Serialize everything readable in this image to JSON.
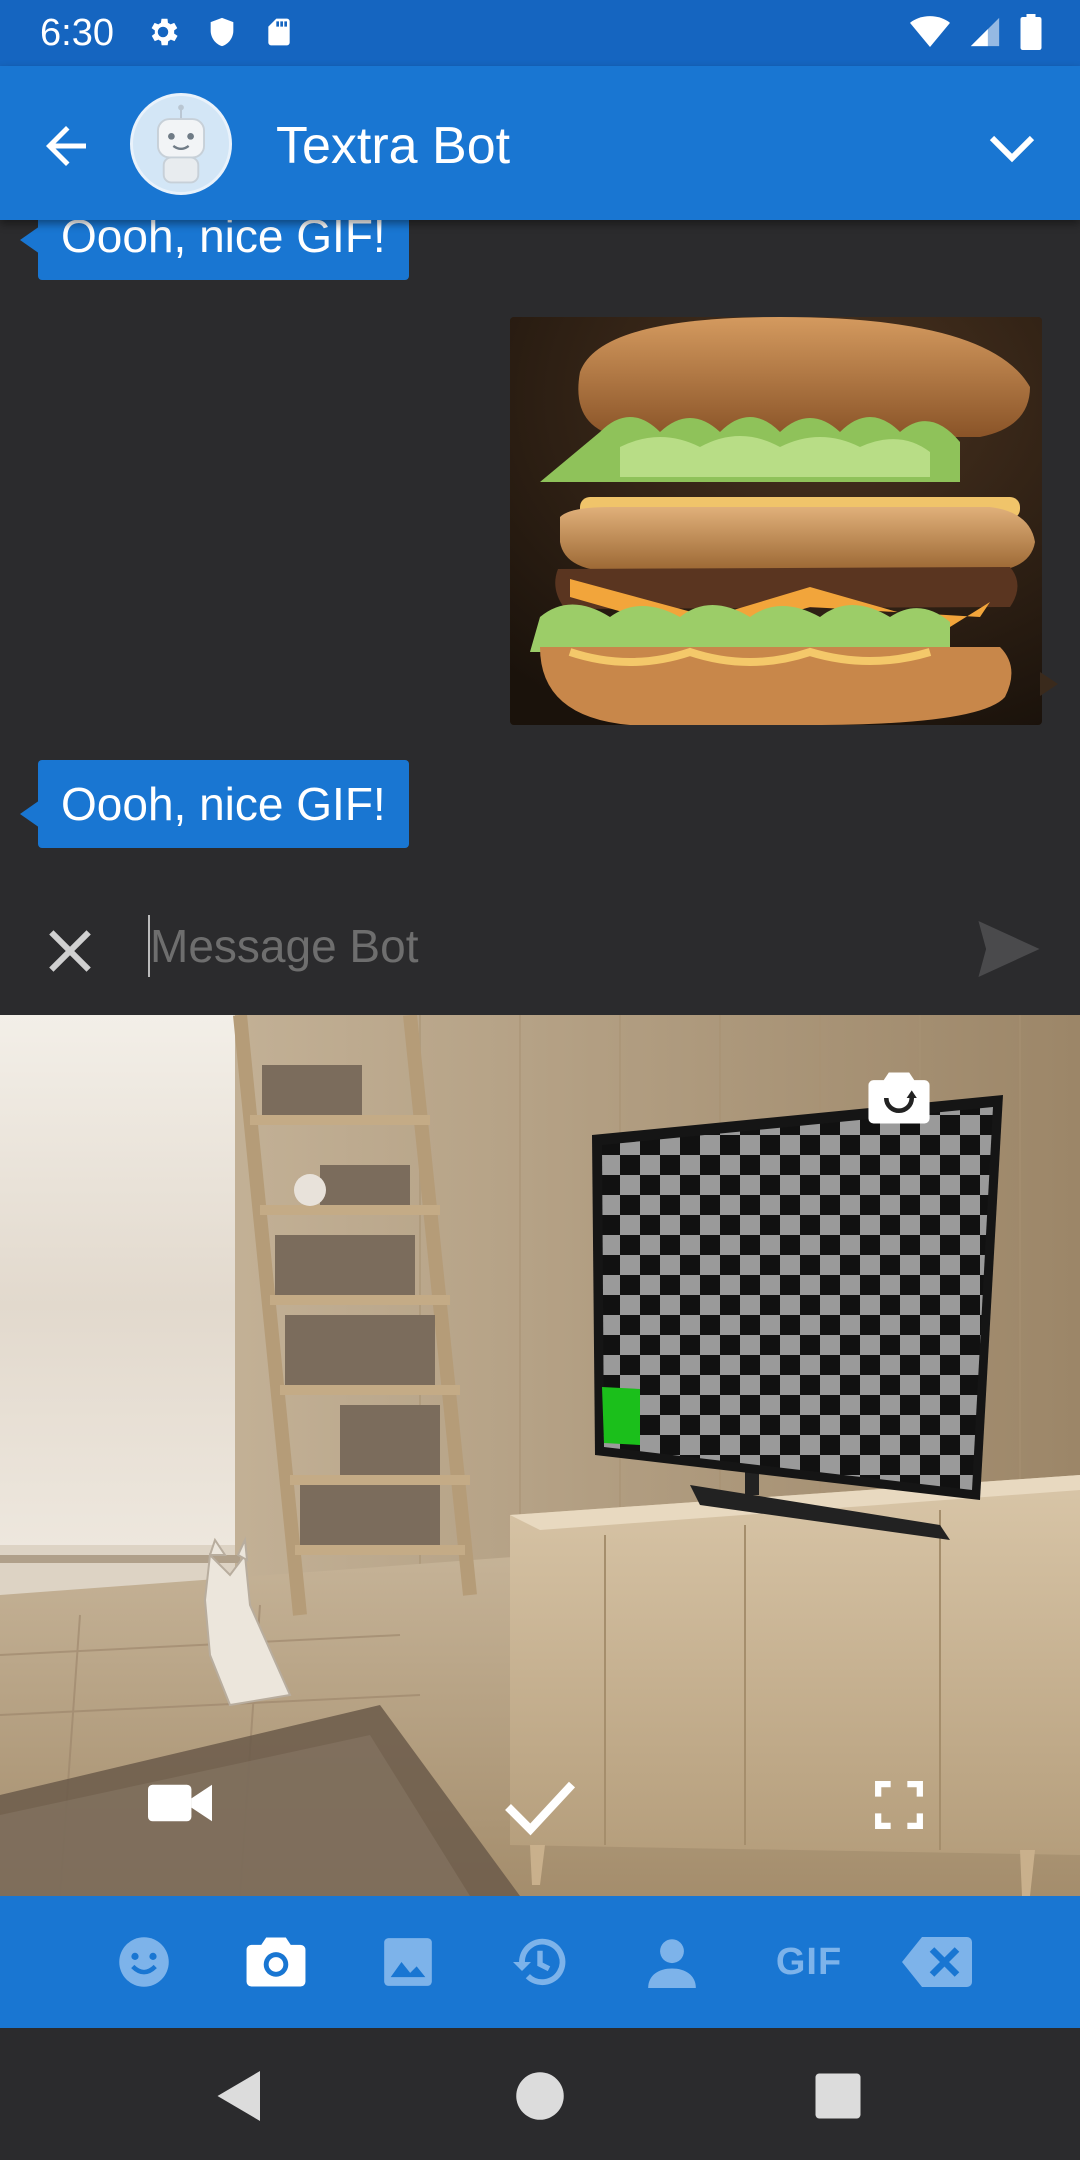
{
  "status_bar": {
    "time": "6:30",
    "left_icons": [
      "settings-icon",
      "shield-icon",
      "sd-card-icon"
    ],
    "right_icons": [
      "wifi-icon",
      "signal-icon",
      "battery-icon"
    ]
  },
  "app_bar": {
    "title": "Textra Bot",
    "back_icon": "arrow-back-icon",
    "expand_icon": "chevron-down-icon",
    "avatar": "robot-avatar"
  },
  "messages": [
    {
      "type": "text",
      "from": "bot",
      "text": "Oooh, nice GIF!"
    },
    {
      "type": "gif",
      "from": "me",
      "content": "burger-gif"
    },
    {
      "type": "text",
      "from": "bot",
      "text": "Oooh, nice GIF!"
    }
  ],
  "composer": {
    "value": "",
    "placeholder": "Message Bot",
    "cancel_icon": "close-icon",
    "send_icon": "send-icon"
  },
  "camera": {
    "controls": [
      "switch-camera-icon",
      "video-icon",
      "capture-check-icon",
      "fullscreen-icon"
    ]
  },
  "attach_bar": {
    "items": [
      {
        "icon": "emoji-icon",
        "active": false
      },
      {
        "icon": "camera-icon",
        "active": true
      },
      {
        "icon": "gallery-icon",
        "active": false
      },
      {
        "icon": "history-icon",
        "active": false
      },
      {
        "icon": "contact-icon",
        "active": false
      },
      {
        "icon": "gif-icon",
        "label": "GIF",
        "active": false
      },
      {
        "icon": "backspace-icon",
        "active": false
      }
    ],
    "colors": {
      "active": "#ffffff",
      "inactive": "#7db3ea"
    }
  },
  "nav_bar": {
    "buttons": [
      "back-triangle-icon",
      "home-circle-icon",
      "recents-square-icon"
    ]
  },
  "colors": {
    "primary": "#1976d2",
    "primary_dark": "#1565c0",
    "background": "#2b2b2d",
    "bubble": "#1976d2"
  }
}
